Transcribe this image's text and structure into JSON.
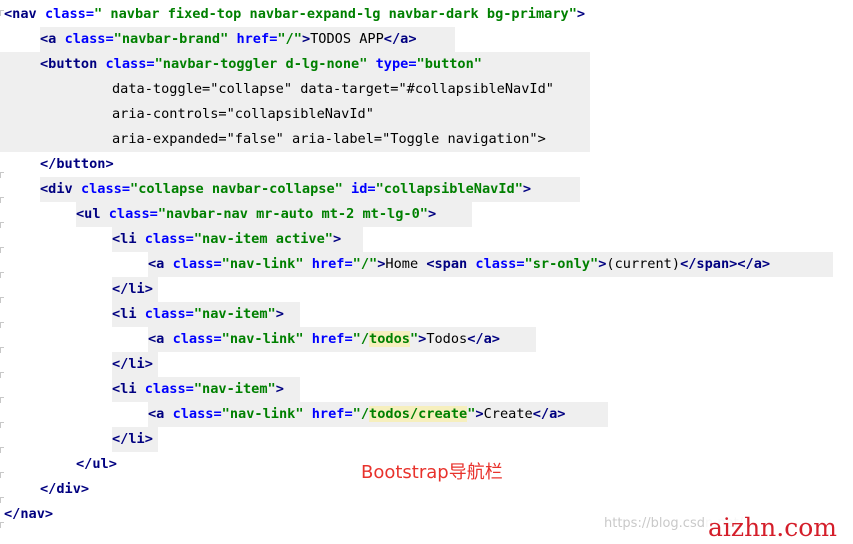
{
  "code": {
    "lines": [
      {
        "text": "<nav class=\" navbar fixed-top navbar-expand-lg navbar-dark bg-primary\">"
      },
      {
        "text": "<a class=\"navbar-brand\" href=\"/\">TODOS APP</a>"
      },
      {
        "text": "<button class=\"navbar-toggler d-lg-none\" type=\"button\""
      },
      {
        "text": "data-toggle=\"collapse\" data-target=\"#collapsibleNavId\""
      },
      {
        "text": "aria-controls=\"collapsibleNavId\""
      },
      {
        "text": "aria-expanded=\"false\" aria-label=\"Toggle navigation\">"
      },
      {
        "text": "</button>"
      },
      {
        "text": "<div class=\"collapse navbar-collapse\" id=\"collapsibleNavId\">"
      },
      {
        "text": "<ul class=\"navbar-nav mr-auto mt-2 mt-lg-0\">"
      },
      {
        "text": "<li class=\"nav-item active\">"
      },
      {
        "text": "<a class=\"nav-link\" href=\"/\">Home <span class=\"sr-only\">(current)</span></a>"
      },
      {
        "text": "</li>"
      },
      {
        "text": "<li class=\"nav-item\">"
      },
      {
        "text": "<a class=\"nav-link\" href=\"/todos\">Todos</a>"
      },
      {
        "text": "</li>"
      },
      {
        "text": "<li class=\"nav-item\">"
      },
      {
        "text": "<a class=\"nav-link\" href=\"/todos/create\">Create</a>"
      },
      {
        "text": "</li>"
      },
      {
        "text": "</ul>"
      },
      {
        "text": "</div>"
      },
      {
        "text": "</nav>"
      }
    ]
  },
  "caption": "Bootstrap导航栏",
  "watermark": {
    "url_text": "https://blog.csdn.net/...",
    "site_text": "aizhn.com"
  },
  "colors": {
    "tag": "#000080",
    "attribute": "#0000ff",
    "value": "#008000",
    "line_highlight": "#efefef",
    "caption": "#e8322c",
    "watermark_site": "#d41e2a"
  }
}
